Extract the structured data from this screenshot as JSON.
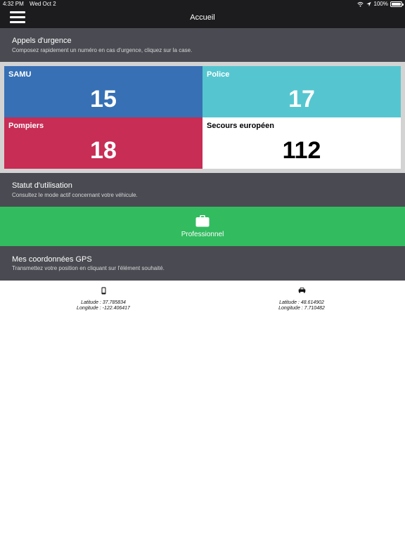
{
  "status_bar": {
    "time": "4:32 PM",
    "date": "Wed Oct 2",
    "battery": "100%"
  },
  "nav": {
    "title": "Accueil",
    "menu_icon": "hamburger-menu-icon"
  },
  "emergency": {
    "title": "Appels d'urgence",
    "subtitle": "Composez rapidement un numéro en cas d'urgence, cliquez sur la case.",
    "tiles": [
      {
        "name": "SAMU",
        "number": "15",
        "color": "#3770b4"
      },
      {
        "name": "Police",
        "number": "17",
        "color": "#55c6d0"
      },
      {
        "name": "Pompiers",
        "number": "18",
        "color": "#c72d55"
      },
      {
        "name": "Secours européen",
        "number": "112",
        "color": "#ffffff"
      }
    ]
  },
  "usage": {
    "title": "Statut d'utilisation",
    "subtitle": "Consultez le mode actif concernant votre véhicule.",
    "mode_label": "Professionnel",
    "mode_icon": "briefcase-icon",
    "mode_color": "#33bb5f"
  },
  "gps": {
    "title": "Mes coordonnées GPS",
    "subtitle": "Transmettez votre position en cliquant sur l'élément souhaité.",
    "sources": [
      {
        "icon": "phone-icon",
        "latitude": "Latitude : 37.785834",
        "longitude": "Longitude : -122.406417"
      },
      {
        "icon": "car-icon",
        "latitude": "Latitude : 48.614902",
        "longitude": "Longitude : 7.710482"
      }
    ]
  }
}
